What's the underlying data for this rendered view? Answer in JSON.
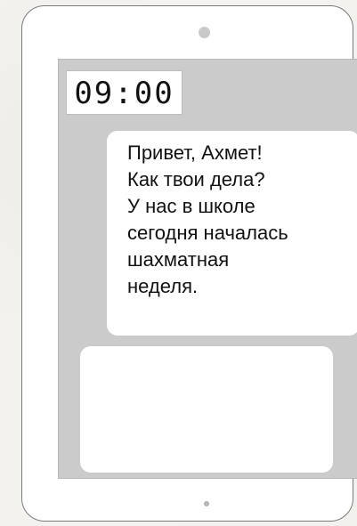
{
  "clock": {
    "time": "09:00"
  },
  "message": {
    "text": "Привет, Ахмет!\nКак твои дела?\nУ нас в школе\nсегодня началась\nшахматная\nнеделя."
  },
  "reply": {
    "text": ""
  },
  "colors": {
    "device_body": "#ffffff",
    "device_outline": "#7a7a7a",
    "screen_background": "#cbcbcb",
    "bubble_background": "#ffffff",
    "text": "#111111"
  },
  "icons": {
    "camera": "camera-icon",
    "home_button": "home-button-icon"
  }
}
